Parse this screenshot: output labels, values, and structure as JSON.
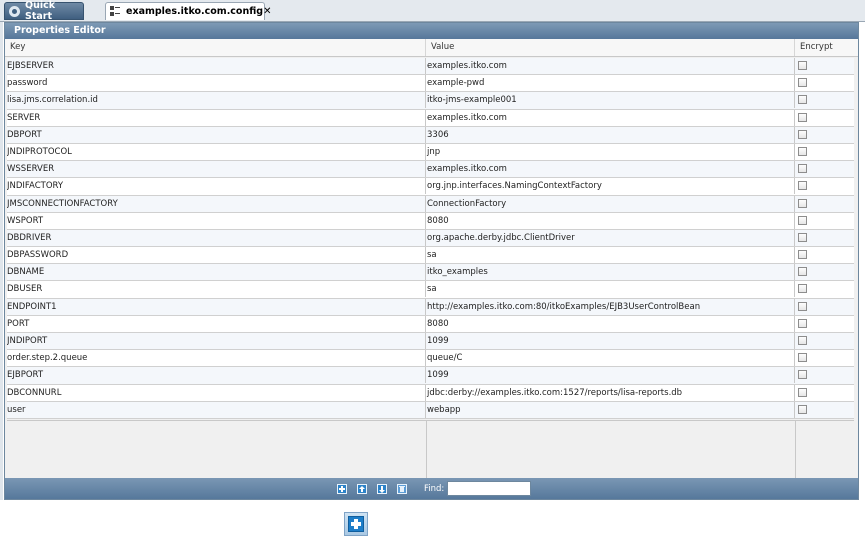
{
  "tabs": [
    {
      "label": "Quick Start",
      "icon": "quick-start-icon"
    },
    {
      "label": "examples.itko.com.config",
      "icon": "config-file-icon",
      "close": "✕"
    }
  ],
  "editor": {
    "title": "Properties Editor",
    "columns": {
      "key": "Key",
      "value": "Value",
      "encrypt": "Encrypt"
    },
    "rows": [
      {
        "key": "EJBSERVER",
        "value": "examples.itko.com",
        "encrypt": false
      },
      {
        "key": "password",
        "value": "example-pwd",
        "encrypt": false
      },
      {
        "key": "lisa.jms.correlation.id",
        "value": "itko-jms-example001",
        "encrypt": false
      },
      {
        "key": "SERVER",
        "value": "examples.itko.com",
        "encrypt": false
      },
      {
        "key": "DBPORT",
        "value": "3306",
        "encrypt": false
      },
      {
        "key": "JNDIPROTOCOL",
        "value": "jnp",
        "encrypt": false
      },
      {
        "key": "WSSERVER",
        "value": "examples.itko.com",
        "encrypt": false
      },
      {
        "key": "JNDIFACTORY",
        "value": "org.jnp.interfaces.NamingContextFactory",
        "encrypt": false
      },
      {
        "key": "JMSCONNECTIONFACTORY",
        "value": "ConnectionFactory",
        "encrypt": false
      },
      {
        "key": "WSPORT",
        "value": "8080",
        "encrypt": false
      },
      {
        "key": "DBDRIVER",
        "value": "org.apache.derby.jdbc.ClientDriver",
        "encrypt": false
      },
      {
        "key": "DBPASSWORD",
        "value": "sa",
        "encrypt": false
      },
      {
        "key": "DBNAME",
        "value": "itko_examples",
        "encrypt": false
      },
      {
        "key": "DBUSER",
        "value": "sa",
        "encrypt": false
      },
      {
        "key": "ENDPOINT1",
        "value": "http://examples.itko.com:80/itkoExamples/EJB3UserControlBean",
        "encrypt": false
      },
      {
        "key": "PORT",
        "value": "8080",
        "encrypt": false
      },
      {
        "key": "JNDIPORT",
        "value": "1099",
        "encrypt": false
      },
      {
        "key": "order.step.2.queue",
        "value": "queue/C",
        "encrypt": false
      },
      {
        "key": "EJBPORT",
        "value": "1099",
        "encrypt": false
      },
      {
        "key": "DBCONNURL",
        "value": "jdbc:derby://examples.itko.com:1527/reports/lisa-reports.db",
        "encrypt": false
      },
      {
        "key": "user",
        "value": "webapp",
        "encrypt": false
      }
    ]
  },
  "toolbar": {
    "buttons": [
      "add-icon",
      "move-up-icon",
      "move-down-icon",
      "delete-icon"
    ],
    "find_label": "Find:",
    "find_value": ""
  },
  "colors": {
    "header_blue": "#56779a",
    "button_blue": "#2c83c9"
  }
}
